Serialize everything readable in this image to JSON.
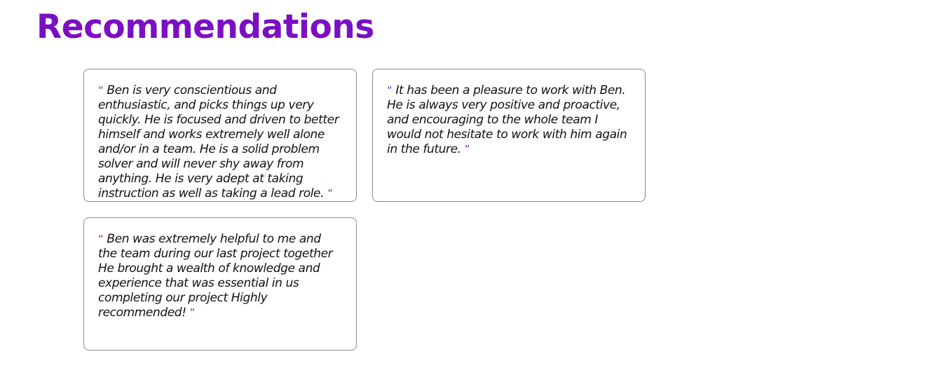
{
  "page": {
    "title": "Recommendations"
  },
  "theme": {
    "accent": "#7b0fc2",
    "card_border": "#8c8c8c",
    "text": "#111111"
  },
  "quote_marks": {
    "open": "“",
    "close": "”"
  },
  "recommendations": [
    {
      "text": "Ben is very conscientious and enthusiastic, and picks things up very quickly. He is focused and driven to better himself and works extremely well alone and/or in a team. He is a solid problem solver and will never shy away from anything. He is very adept at taking instruction as well as taking a lead role."
    },
    {
      "text": "It has been a pleasure to work with Ben. He is always very positive and proactive, and encouraging to the whole team I would not hesitate to work with him again in the future."
    },
    {
      "text": "Ben was extremely helpful to me and the team during our last project together He brought a wealth of knowledge and experience that was essential in us completing our project Highly recommended!"
    }
  ]
}
